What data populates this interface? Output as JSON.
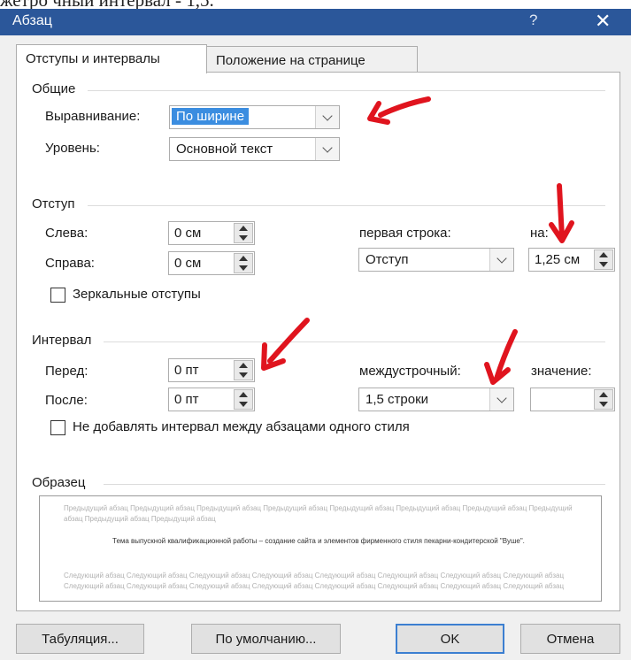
{
  "top_text": "жетро чный интервал - 1,5.",
  "window": {
    "title": "Абзац",
    "help": "?",
    "close": "✕"
  },
  "tabs": [
    {
      "label": "Отступы и интервалы",
      "active": true
    },
    {
      "label": "Положение на странице",
      "active": false
    }
  ],
  "general": {
    "title": "Общие",
    "alignment_label": "Выравнивание:",
    "alignment_value": "По ширине",
    "level_label": "Уровень:",
    "level_value": "Основной текст"
  },
  "indent": {
    "title": "Отступ",
    "left_label": "Слева:",
    "left_value": "0 см",
    "right_label": "Справа:",
    "right_value": "0 см",
    "first_line_label": "первая строка:",
    "first_line_value": "Отступ",
    "by_label": "на:",
    "by_value": "1,25 см",
    "mirror_label": "Зеркальные отступы",
    "mirror_checked": false
  },
  "spacing": {
    "title": "Интервал",
    "before_label": "Перед:",
    "before_value": "0 пт",
    "after_label": "После:",
    "after_value": "0 пт",
    "line_label": "междустрочный:",
    "line_value": "1,5 строки",
    "at_label": "значение:",
    "at_value": "",
    "dont_add_label": "Не добавлять интервал между абзацами одного стиля",
    "dont_add_checked": false
  },
  "preview": {
    "title": "Образец",
    "previous_text": "Предыдущий абзац Предыдущий абзац Предыдущий абзац Предыдущий абзац Предыдущий абзац Предыдущий абзац Предыдущий абзац Предыдущий абзац Предыдущий абзац Предыдущий абзац",
    "sample_text": "Тема выпускной квалификационной работы – создание сайта и элементов фирменного стиля пекарни-кондитерской \"Вуше\".",
    "next_text": "Следующий абзац Следующий абзац Следующий абзац Следующий абзац Следующий абзац Следующий абзац Следующий абзац Следующий абзац Следующий абзац Следующий абзац Следующий абзац Следующий абзац Следующий абзац Следующий абзац Следующий абзац Следующий абзац"
  },
  "buttons": {
    "tabs": "Табуляция...",
    "default": "По умолчанию...",
    "ok": "OK",
    "cancel": "Отмена"
  },
  "colors": {
    "titlebar": "#2b579a",
    "selection": "#3b8de0",
    "annotation": "#e0141e"
  }
}
